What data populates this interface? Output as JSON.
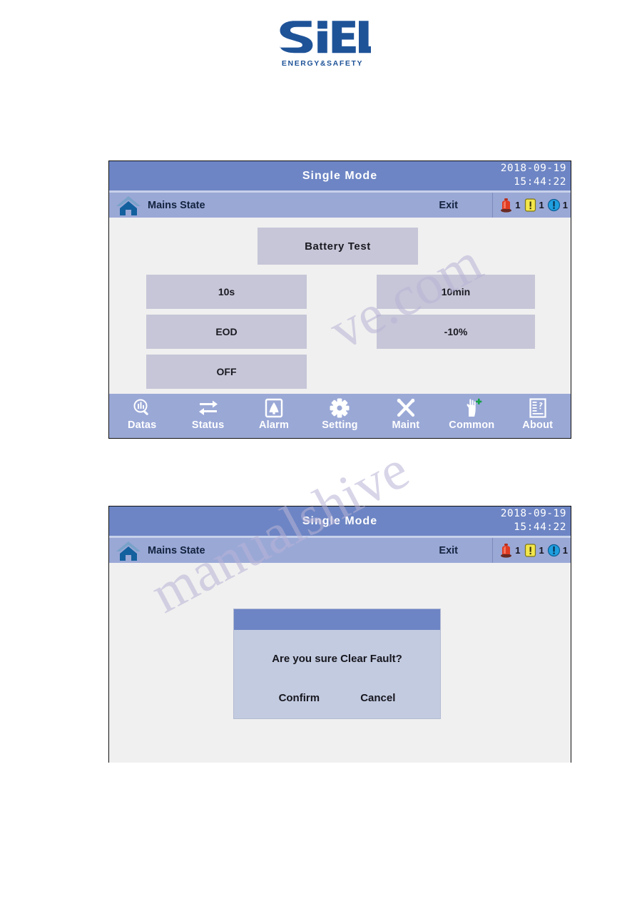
{
  "brand": {
    "name": "SIEL",
    "tagline": "ENERGY&SAFETY",
    "color": "#1f5398"
  },
  "theme": {
    "titlebar_blue": "#6d85c4",
    "subbar_blue": "#9aa8d6",
    "button_grey": "#c6c6d8",
    "screen_bg": "#f0f0f0",
    "alarm_red": "#e03a22",
    "alarm_yellow": "#f2e64b",
    "alarm_blue": "#1f9fe0"
  },
  "screens": [
    {
      "id": "battery-test-screen",
      "header": {
        "title": "Single  Mode",
        "date": "2018-09-19",
        "time": "15:44:22",
        "home_icon": "home-icon",
        "state_label": "Mains State",
        "exit_label": "Exit",
        "alarms": [
          {
            "icon": "alarm-beacon-icon",
            "count": "1"
          },
          {
            "icon": "warning-triangle-icon",
            "count": "1"
          },
          {
            "icon": "info-circle-icon",
            "count": "1"
          }
        ]
      },
      "content": {
        "heading_button": "Battery  Test",
        "left_buttons": [
          "10s",
          "EOD",
          "OFF"
        ],
        "right_buttons": [
          "10min",
          "-10%"
        ]
      },
      "nav": [
        {
          "label": "Datas",
          "icon": "data-search-icon"
        },
        {
          "label": "Status",
          "icon": "transfer-arrows-icon"
        },
        {
          "label": "Alarm",
          "icon": "bell-icon"
        },
        {
          "label": "Setting",
          "icon": "gear-icon"
        },
        {
          "label": "Maint",
          "icon": "tools-icon"
        },
        {
          "label": "Common",
          "icon": "hand-plus-icon"
        },
        {
          "label": "About",
          "icon": "document-question-icon"
        }
      ]
    },
    {
      "id": "clear-fault-dialog-screen",
      "header": {
        "title": "Single  Mode",
        "date": "2018-09-19",
        "time": "15:44:22",
        "home_icon": "home-icon",
        "state_label": "Mains State",
        "exit_label": "Exit",
        "alarms": [
          {
            "icon": "alarm-beacon-icon",
            "count": "1"
          },
          {
            "icon": "warning-triangle-icon",
            "count": "1"
          },
          {
            "icon": "info-circle-icon",
            "count": "1"
          }
        ]
      },
      "dialog": {
        "title": "",
        "message": "Are you sure Clear Fault?",
        "confirm_label": "Confirm",
        "cancel_label": "Cancel"
      }
    }
  ],
  "watermark": {
    "line1": "ve.com",
    "line2": "manualshive"
  }
}
